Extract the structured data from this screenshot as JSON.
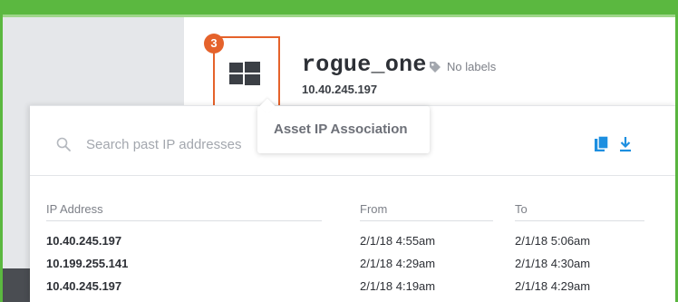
{
  "step_badge": "3",
  "asset": {
    "name": "rogue_one",
    "ip": "10.40.245.197",
    "labels_text": "No labels",
    "os_icon": "windows-icon",
    "tag_icon": "tag-icon"
  },
  "tooltip": {
    "text": "Asset IP Association"
  },
  "search": {
    "placeholder": "Search past IP addresses",
    "value": ""
  },
  "toolbar": {
    "copy_icon": "copy-icon",
    "download_icon": "download-icon"
  },
  "table": {
    "headers": [
      "IP Address",
      "From",
      "To"
    ],
    "rows": [
      [
        "10.40.245.197",
        "2/1/18 4:55am",
        "2/1/18 5:06am"
      ],
      [
        "10.199.255.141",
        "2/1/18 4:29am",
        "2/1/18 4:30am"
      ],
      [
        "10.40.245.197",
        "2/1/18 4:19am",
        "2/1/18 4:29am"
      ]
    ]
  },
  "colors": {
    "accent_green": "#5bb840",
    "highlight_orange": "#e5622b",
    "icon_blue": "#1d8fe0"
  }
}
